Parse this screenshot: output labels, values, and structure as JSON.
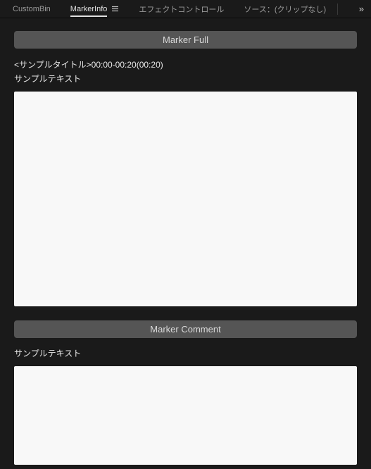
{
  "tabs": {
    "custom_bin": "CustomBin",
    "marker_info": "MarkerInfo",
    "effect_controls": "エフェクトコントロール",
    "source": "ソース：(クリップなし)"
  },
  "section_full": {
    "header": "Marker Full",
    "title_line": "<サンプルタイトル>00:00-00:20(00:20)",
    "sample_text": "サンプルテキスト"
  },
  "section_comment": {
    "header": "Marker Comment",
    "sample_text": "サンプルテキスト"
  }
}
